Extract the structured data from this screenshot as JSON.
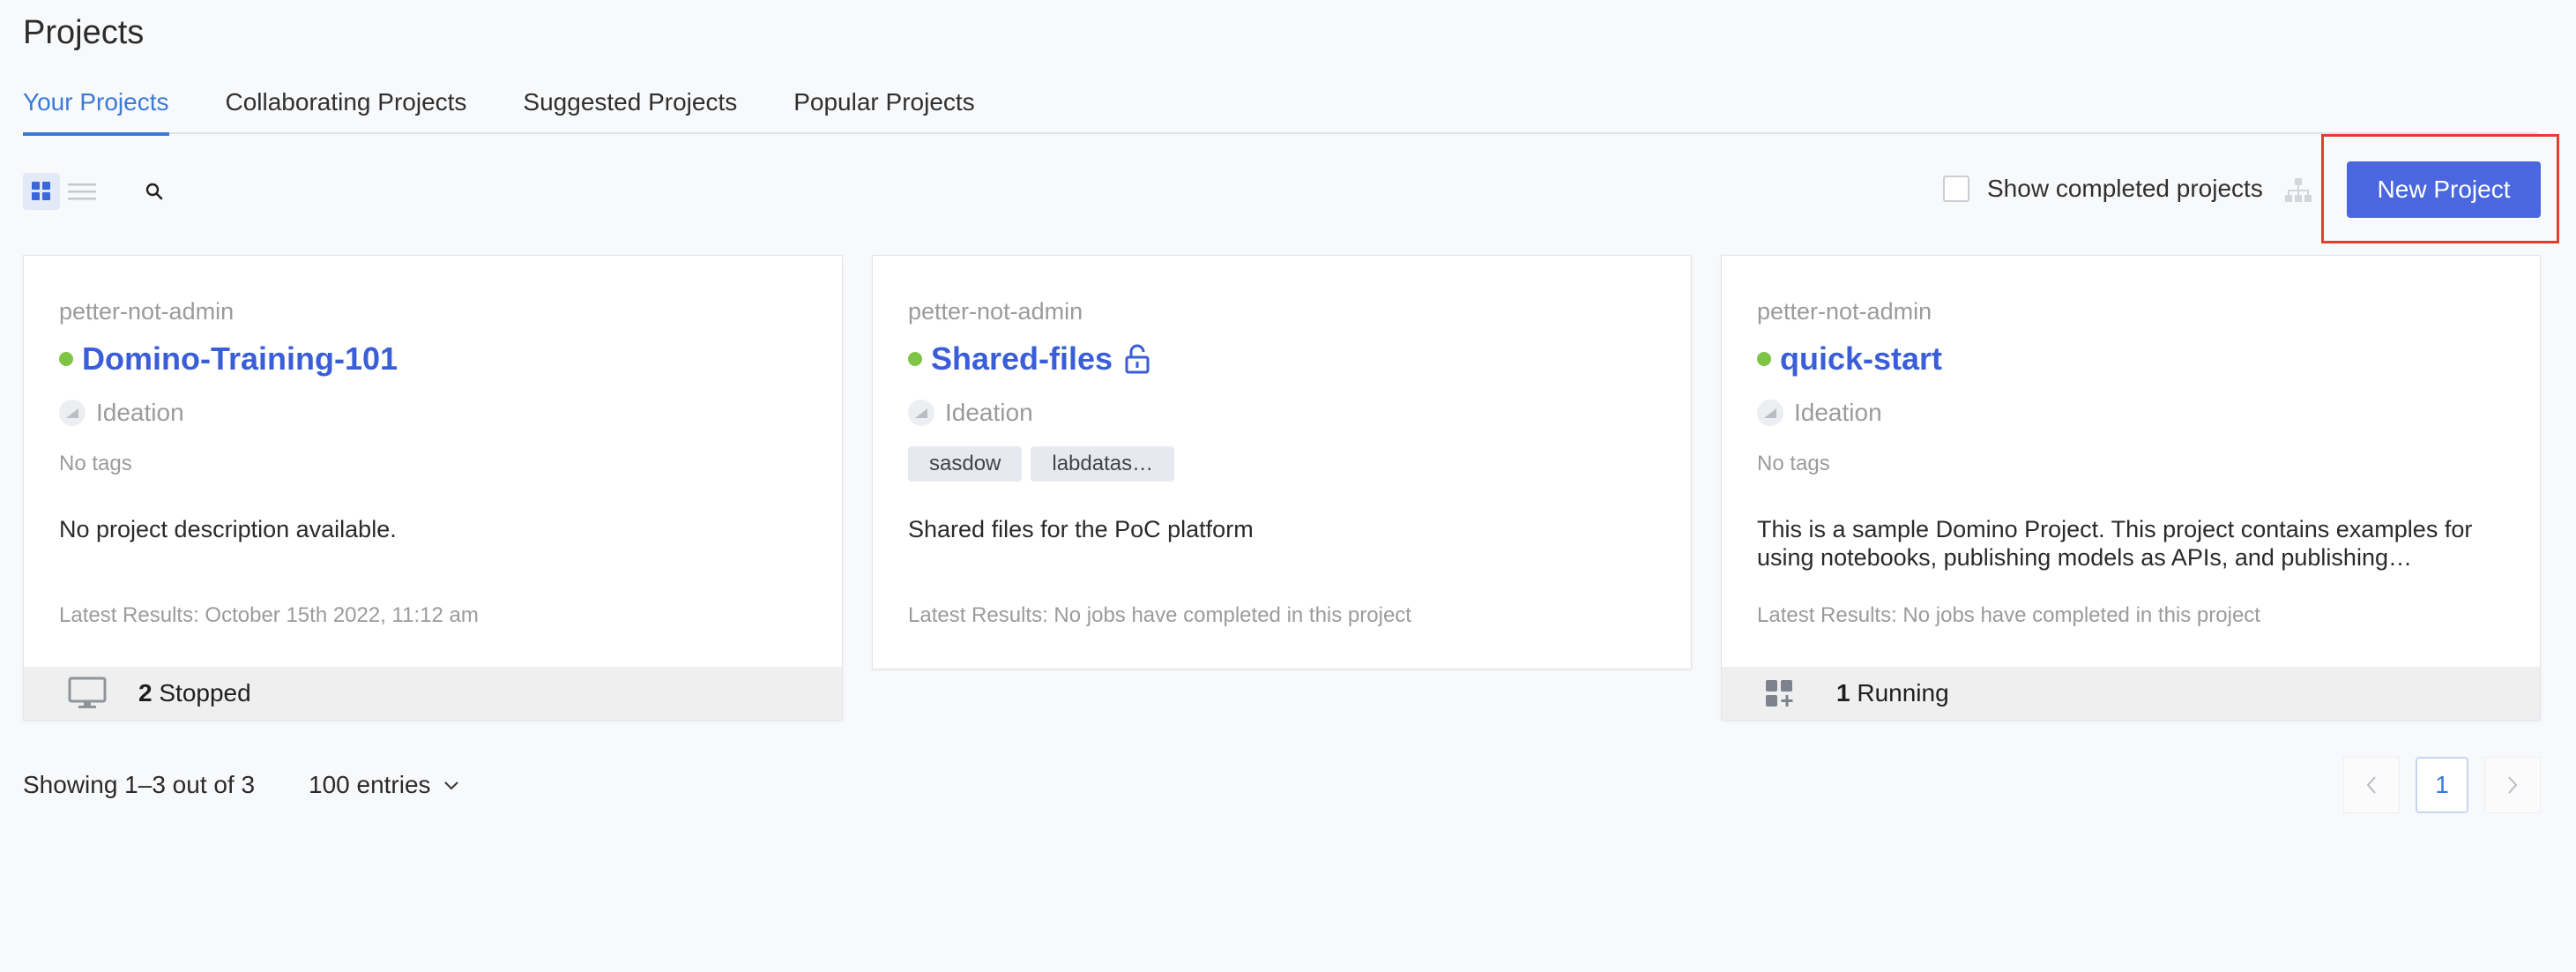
{
  "page": {
    "title": "Projects"
  },
  "tabs": [
    {
      "label": "Your Projects",
      "active": true
    },
    {
      "label": "Collaborating Projects"
    },
    {
      "label": "Suggested Projects"
    },
    {
      "label": "Popular Projects"
    }
  ],
  "toolbar": {
    "show_completed_label": "Show completed projects",
    "show_completed_checked": false,
    "new_project_label": "New Project",
    "view_mode": "grid"
  },
  "projects": [
    {
      "owner": "petter-not-admin",
      "name": "Domino-Training-101",
      "status_color": "#7ec445",
      "stage": "Ideation",
      "tags_text": "No tags",
      "description": "No project description available.",
      "latest_results": "Latest Results: October 15th 2022, 11:12 am",
      "footer": {
        "icon": "monitor-icon",
        "count": "2",
        "label": "Stopped"
      }
    },
    {
      "owner": "petter-not-admin",
      "name": "Shared-files",
      "status_color": "#7ec445",
      "stage": "Ideation",
      "tags": [
        "sasdow",
        "labdatas…"
      ],
      "description": "Shared files for the PoC platform",
      "latest_results": "Latest Results: No jobs have completed in this project",
      "locked_icon": "unlock-icon"
    },
    {
      "owner": "petter-not-admin",
      "name": "quick-start",
      "status_color": "#7ec445",
      "stage": "Ideation",
      "tags_text": "No tags",
      "description": "This is a sample Domino Project. This project contains examples for using notebooks, publishing models as APIs, and publishing…",
      "latest_results": "Latest Results: No jobs have completed in this project",
      "footer": {
        "icon": "apps-add-icon",
        "count": "1",
        "label": "Running"
      }
    }
  ],
  "pagination": {
    "showing": "Showing 1–3 out of 3",
    "entries": "100 entries",
    "current_page": "1"
  },
  "colors": {
    "accent": "#3a7ad9",
    "primary_button": "#4a67e0",
    "highlight": "#e2402c",
    "status_green": "#7ec445"
  }
}
